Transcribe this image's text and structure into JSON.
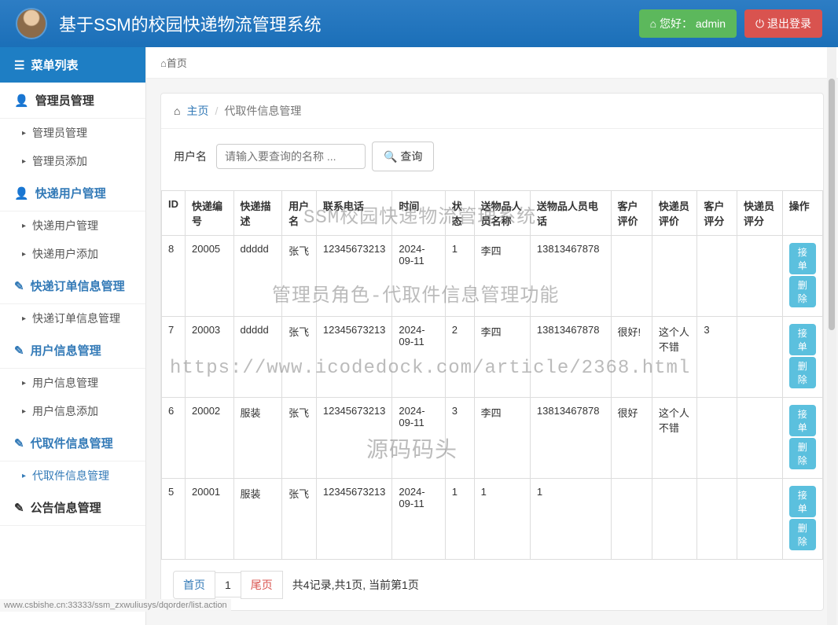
{
  "header": {
    "title": "基于SSM的校园快递物流管理系统",
    "greeting": "您好：",
    "username": "admin",
    "logout": "退出登录"
  },
  "sidebar": {
    "menu_title": "菜单列表",
    "sections": [
      {
        "label": "管理员管理",
        "items": [
          "管理员管理",
          "管理员添加"
        ],
        "active": false
      },
      {
        "label": "快递用户管理",
        "items": [
          "快递用户管理",
          "快递用户添加"
        ],
        "active": true
      },
      {
        "label": "快递订单信息管理",
        "items": [
          "快递订单信息管理"
        ],
        "active": true
      },
      {
        "label": "用户信息管理",
        "items": [
          "用户信息管理",
          "用户信息添加"
        ],
        "active": true
      },
      {
        "label": "代取件信息管理",
        "items": [
          "代取件信息管理"
        ],
        "active": true,
        "current": true
      },
      {
        "label": "公告信息管理",
        "items": [],
        "active": false
      }
    ]
  },
  "breadcrumb_top": "首页",
  "breadcrumb": {
    "home": "主页",
    "current": "代取件信息管理"
  },
  "search": {
    "label": "用户名",
    "placeholder": "请输入要查询的名称 ...",
    "button": "查询"
  },
  "table": {
    "headers": [
      "ID",
      "快递编号",
      "快递描述",
      "用户名",
      "联系电话",
      "时间",
      "状态",
      "送物品人员名称",
      "送物品人员电话",
      "客户评价",
      "快递员评价",
      "客户评分",
      "快递员评分",
      "操作"
    ],
    "rows": [
      {
        "id": "8",
        "code": "20005",
        "desc": "ddddd",
        "user": "张飞",
        "phone": "12345673213",
        "time": "2024-09-11",
        "status": "1",
        "dname": "李四",
        "dphone": "13813467878",
        "crev": "",
        "drev": "",
        "cscore": "",
        "dscore": ""
      },
      {
        "id": "7",
        "code": "20003",
        "desc": "ddddd",
        "user": "张飞",
        "phone": "12345673213",
        "time": "2024-09-11",
        "status": "2",
        "dname": "李四",
        "dphone": "13813467878",
        "crev": "很好!",
        "drev": "这个人不错",
        "cscore": "3",
        "dscore": ""
      },
      {
        "id": "6",
        "code": "20002",
        "desc": "服装",
        "user": "张飞",
        "phone": "12345673213",
        "time": "2024-09-11",
        "status": "3",
        "dname": "李四",
        "dphone": "13813467878",
        "crev": "很好",
        "drev": "这个人不错",
        "cscore": "",
        "dscore": ""
      },
      {
        "id": "5",
        "code": "20001",
        "desc": "服装",
        "user": "张飞",
        "phone": "12345673213",
        "time": "2024-09-11",
        "status": "1",
        "dname": "1",
        "dphone": "1",
        "crev": "",
        "drev": "",
        "cscore": "",
        "dscore": ""
      }
    ],
    "action_accept": "接单",
    "action_delete": "删除"
  },
  "pagination": {
    "first": "首页",
    "current": "1",
    "last": "尾页",
    "info": "共4记录,共1页, 当前第1页"
  },
  "watermarks": {
    "w1": "SSM校园快递物流管理系统",
    "w2": "管理员角色-代取件信息管理功能",
    "w3": "https://www.icodedock.com/article/2368.html",
    "w4": "源码码头"
  },
  "url": "www.csbishe.cn:33333/ssm_zxwuliusys/dqorder/list.action"
}
